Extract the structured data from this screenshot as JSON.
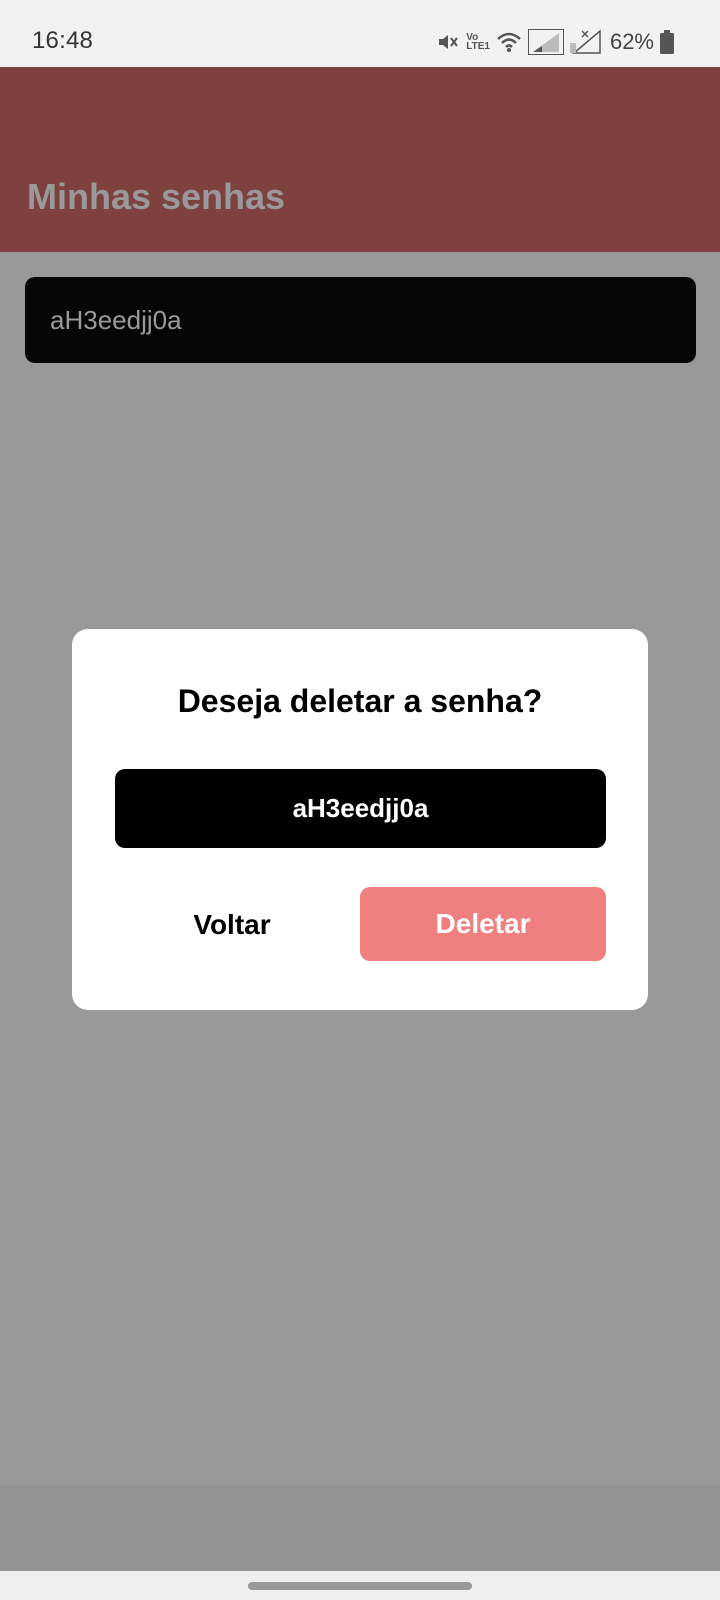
{
  "status_bar": {
    "time": "16:48",
    "volte_label_top": "Vo",
    "volte_label_bottom": "LTE1",
    "battery_percent": "62%",
    "icons": [
      "mute-icon",
      "volte-icon",
      "wifi-icon",
      "signal-1-icon",
      "signal-2-no-service-icon",
      "battery-icon"
    ]
  },
  "app_bar": {
    "title": "Minhas senhas",
    "color": "#d46b6b"
  },
  "passwords": [
    {
      "value": "aH3eedjj0a"
    }
  ],
  "dialog": {
    "title": "Deseja deletar a senha?",
    "password": "aH3eedjj0a",
    "back_label": "Voltar",
    "delete_label": "Deletar",
    "delete_color": "#f08080"
  }
}
